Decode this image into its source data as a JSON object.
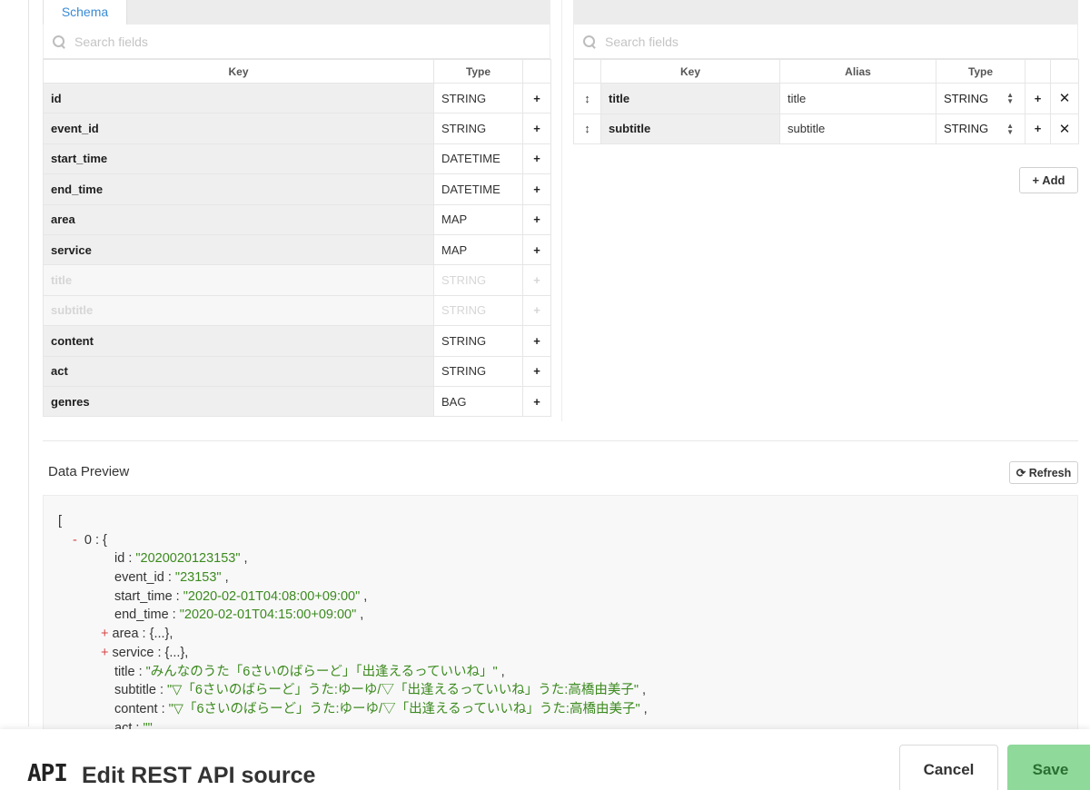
{
  "schema_panel": {
    "tab": "Schema",
    "search_placeholder": "Search fields",
    "columns": {
      "key": "Key",
      "type": "Type"
    },
    "rows": [
      {
        "key": "id",
        "type": "STRING",
        "muted": false
      },
      {
        "key": "event_id",
        "type": "STRING",
        "muted": false
      },
      {
        "key": "start_time",
        "type": "DATETIME",
        "muted": false
      },
      {
        "key": "end_time",
        "type": "DATETIME",
        "muted": false
      },
      {
        "key": "area",
        "type": "MAP",
        "muted": false
      },
      {
        "key": "service",
        "type": "MAP",
        "muted": false
      },
      {
        "key": "title",
        "type": "STRING",
        "muted": true
      },
      {
        "key": "subtitle",
        "type": "STRING",
        "muted": true
      },
      {
        "key": "content",
        "type": "STRING",
        "muted": false
      },
      {
        "key": "act",
        "type": "STRING",
        "muted": false
      },
      {
        "key": "genres",
        "type": "BAG",
        "muted": false
      }
    ]
  },
  "mapping_panel": {
    "search_placeholder": "Search fields",
    "columns": {
      "key": "Key",
      "alias": "Alias",
      "type": "Type"
    },
    "rows": [
      {
        "key": "title",
        "alias": "title",
        "type": "STRING"
      },
      {
        "key": "subtitle",
        "alias": "subtitle",
        "type": "STRING"
      }
    ],
    "add_label": "+ Add"
  },
  "preview": {
    "title": "Data Preview",
    "refresh_label": "Refresh",
    "lines": {
      "l0": "[",
      "l1_toggle": "-",
      "l1": "0 : {",
      "id_key": "id : ",
      "id_val": "\"2020020123153\"",
      "event_key": "event_id : ",
      "event_val": "\"23153\"",
      "start_key": "start_time : ",
      "start_val": "\"2020-02-01T04:08:00+09:00\"",
      "end_key": "end_time : ",
      "end_val": "\"2020-02-01T04:15:00+09:00\"",
      "area_toggle": "+",
      "area": "area : {...},",
      "service_toggle": "+",
      "service": "service : {...},",
      "title_key": "title : ",
      "title_val": "\"みんなのうた「6さいのばらーど」「出逢えるっていいね」\"",
      "subtitle_key": "subtitle : ",
      "subtitle_val": "\"▽「6さいのばらーど」うた:ゆーゆ/▽「出逢えるっていいね」うた:高橋由美子\"",
      "content_key": "content : ",
      "content_val": "\"▽「6さいのばらーど」うた:ゆーゆ/▽「出逢えるっていいね」うた:高橋由美子\"",
      "act_key": "act : ",
      "act_val": "\"\""
    }
  },
  "footer": {
    "icon_text": "API",
    "title": "Edit REST API source",
    "cancel": "Cancel",
    "save": "Save"
  },
  "colors": {
    "accent": "#3a8bd4",
    "save": "#8fd99a",
    "string": "#3c8a1f",
    "toggle": "#d64545"
  }
}
